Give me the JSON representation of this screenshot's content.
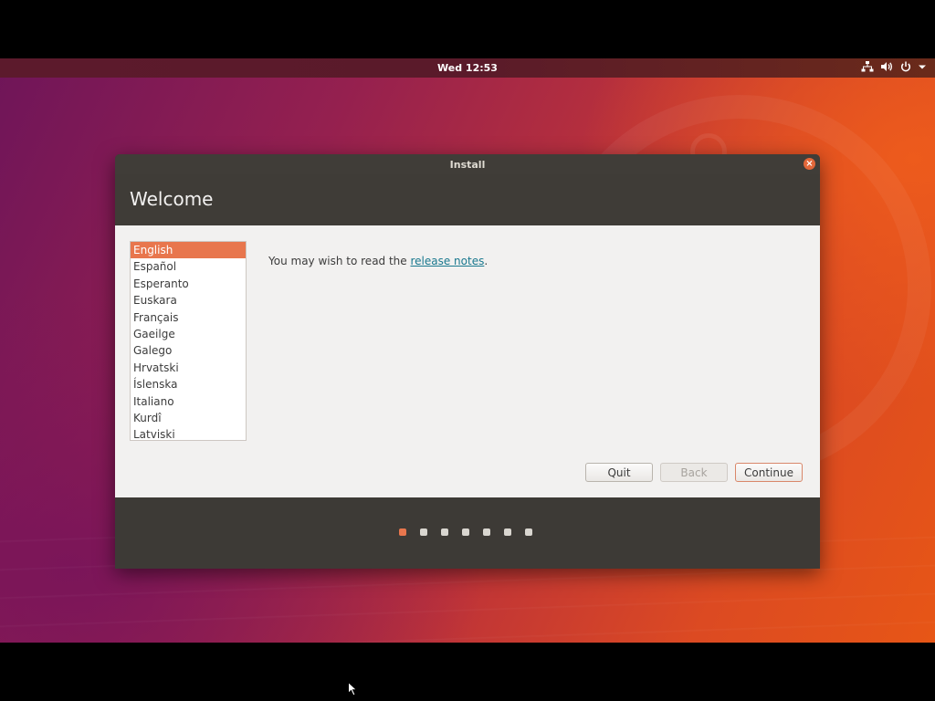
{
  "topbar": {
    "clock": "Wed 12:53",
    "icons": [
      "network-icon",
      "volume-icon",
      "power-icon",
      "menu-arrow-icon"
    ]
  },
  "window": {
    "title": "Install",
    "heading": "Welcome",
    "languages": [
      "English",
      "Español",
      "Esperanto",
      "Euskara",
      "Français",
      "Gaeilge",
      "Galego",
      "Hrvatski",
      "Íslenska",
      "Italiano",
      "Kurdî",
      "Latviski"
    ],
    "selected_language": "English",
    "notes_prefix": "You may wish to read the ",
    "notes_link": "release notes",
    "notes_suffix": ".",
    "buttons": {
      "quit": "Quit",
      "back": "Back",
      "continue": "Continue"
    },
    "steps": {
      "total": 7,
      "current": 1
    }
  },
  "colors": {
    "accent": "#e8764d",
    "link": "#19788e",
    "dark_panel": "#3d3a36"
  }
}
